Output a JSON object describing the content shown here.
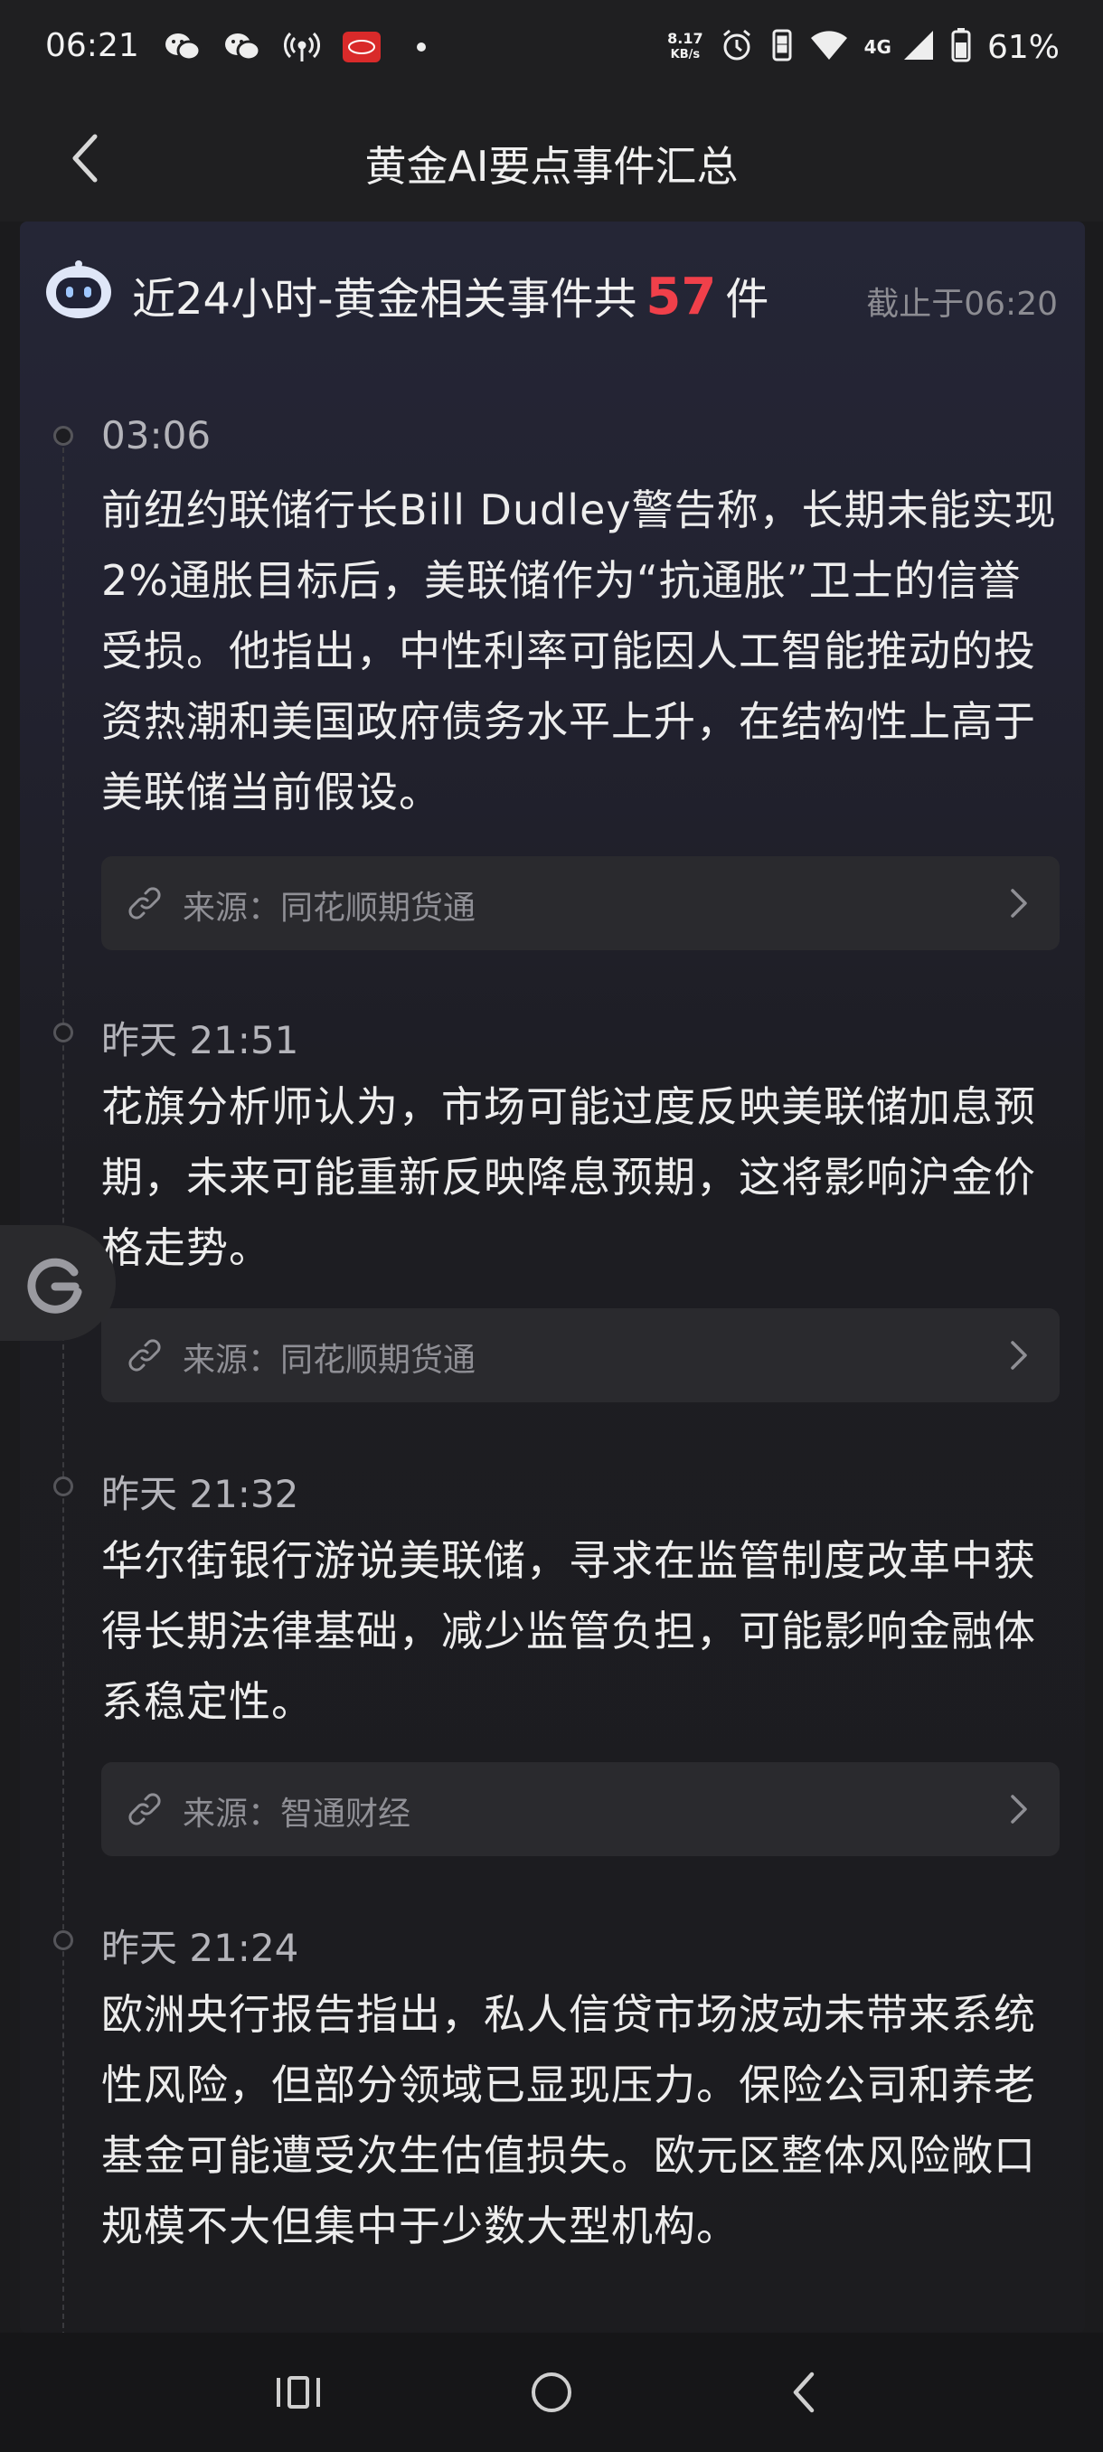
{
  "status_bar": {
    "time": "06:21",
    "net_speed_value": "8.17",
    "net_speed_unit": "KB/s",
    "network_type": "4G",
    "battery": "61%",
    "icons": [
      "wechat-icon",
      "wechat-icon",
      "hotspot-icon",
      "byd-app-icon",
      "dot-icon",
      "alarm-icon",
      "vibrate-icon",
      "wifi-icon",
      "signal-icon",
      "battery-icon"
    ]
  },
  "header": {
    "title": "黄金AI要点事件汇总",
    "back_icon": "chevron-left-icon"
  },
  "summary": {
    "prefix": "近24小时-黄金相关事件共",
    "count": "57",
    "suffix": "件",
    "cutoff": "截止于06:20"
  },
  "events": [
    {
      "time": "03:06",
      "text": "前纽约联储行长Bill Dudley警告称，长期未能实现2%通胀目标后，美联储作为“抗通胀”卫士的信誉受损。他指出，中性利率可能因人工智能推动的投资热潮和美国政府债务水平上升，在结构性上高于美联储当前假设。",
      "source": "来源：同花顺期货通"
    },
    {
      "time": "昨天 21:51",
      "text": "花旗分析师认为，市场可能过度反映美联储加息预期，未来可能重新反映降息预期，这将影响沪金价格走势。",
      "source": "来源：同花顺期货通"
    },
    {
      "time": "昨天 21:32",
      "text": "华尔街银行游说美联储，寻求在监管制度改革中获得长期法律基础，减少监管负担，可能影响金融体系稳定性。",
      "source": "来源：智通财经"
    },
    {
      "time": "昨天 21:24",
      "text": "欧洲央行报告指出，私人信贷市场波动未带来系统性风险，但部分领域已显现压力。保险公司和养老基金可能遭受次生估值损失。欧元区整体风险敞口规模不大但集中于少数大型机构。",
      "source": ""
    }
  ],
  "nav_bar": {
    "icons": [
      "recent-apps-icon",
      "home-icon",
      "back-icon"
    ]
  },
  "colors": {
    "accent_count": "#f0404a",
    "background": "#1b1b1d"
  }
}
